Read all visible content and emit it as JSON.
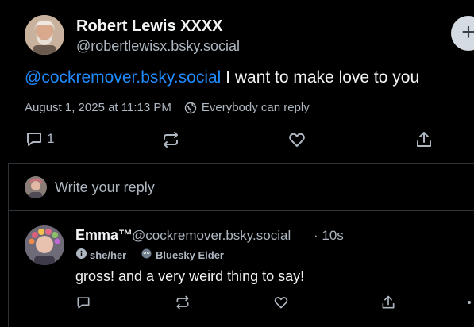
{
  "post": {
    "author_name": "Robert Lewis XXXX",
    "author_handle": "@robertlewisx.bsky.social",
    "mention": "@cockremover.bsky.social",
    "body": " I want to make love to you",
    "timestamp": "August 1, 2025 at 11:13 PM",
    "reply_settings": "Everybody can reply",
    "reply_count": "1"
  },
  "composer": {
    "placeholder": "Write your reply"
  },
  "reply": {
    "author_name": "Emma™",
    "author_handle": "@cockremover.bsky.social",
    "time_ago": "· 10s",
    "pronouns": "she/her",
    "badge": "Bluesky Elder",
    "body": "gross! and a very weird thing to say!"
  },
  "fab": {
    "label": "+"
  },
  "colors": {
    "background": "#000000",
    "text": "#f1f3f5",
    "muted": "#aeb7c1",
    "link": "#208bfe",
    "divider": "#2e3338"
  }
}
